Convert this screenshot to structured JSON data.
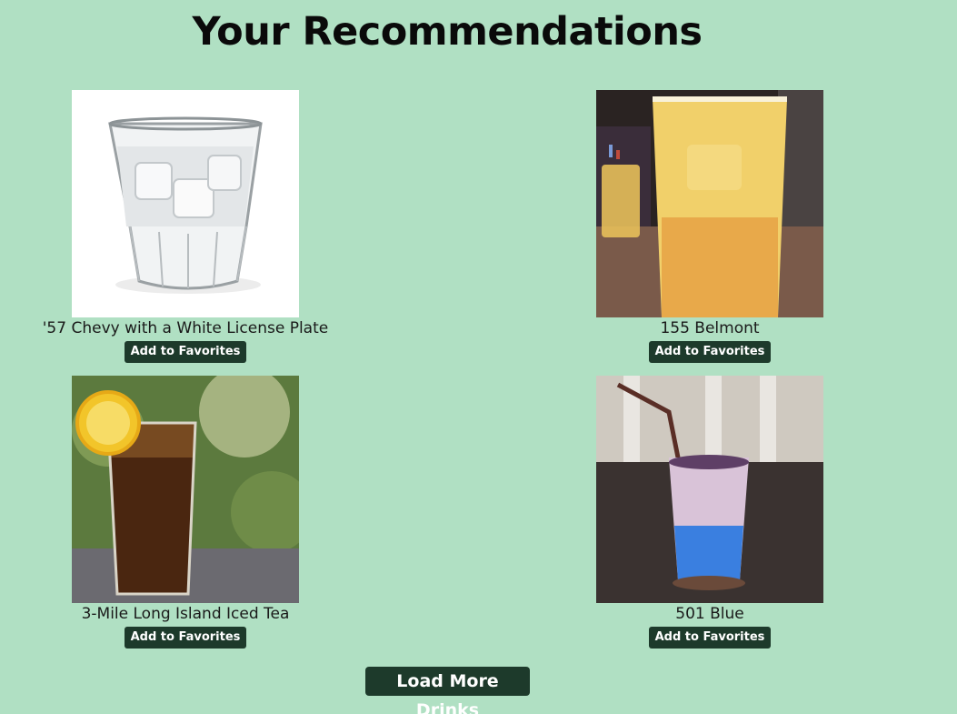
{
  "page": {
    "title": "Your Recommendations"
  },
  "drinks": [
    {
      "name": "'57 Chevy with a White License Plate",
      "button": "Add to Favorites",
      "image": "clear-iced-drink-in-rocks-glass"
    },
    {
      "name": "155 Belmont",
      "button": "Add to Favorites",
      "image": "orange-yellow-drink-in-pint-glass"
    },
    {
      "name": "3-Mile Long Island Iced Tea",
      "button": "Add to Favorites",
      "image": "iced-tea-with-lemon-slice"
    },
    {
      "name": "501 Blue",
      "button": "Add to Favorites",
      "image": "blue-layered-drink-with-straw"
    }
  ],
  "actions": {
    "load_more": "Load More Drinks"
  },
  "colors": {
    "background": "#b0e0c3",
    "button": "#1d3a2b",
    "button_text": "#ffffff"
  }
}
